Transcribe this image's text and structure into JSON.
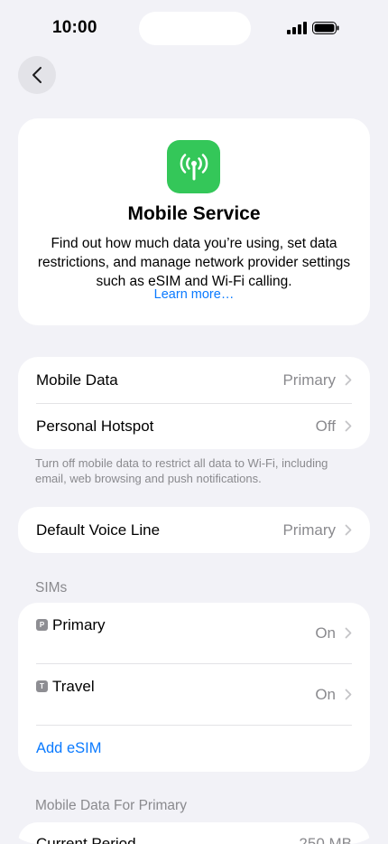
{
  "status_bar": {
    "time": "10:00"
  },
  "hero": {
    "title": "Mobile Service",
    "description": "Find out how much data you’re using, set data restrictions, and manage network provider settings such as eSIM and Wi-Fi calling.",
    "link": "Learn more…"
  },
  "data_group": {
    "rows": [
      {
        "label": "Mobile Data",
        "value": "Primary"
      },
      {
        "label": "Personal Hotspot",
        "value": "Off"
      }
    ],
    "footnote": "Turn off mobile data to restrict all data to Wi-Fi, including email, web browsing and push notifications."
  },
  "voice_group": {
    "rows": [
      {
        "label": "Default Voice Line",
        "value": "Primary"
      }
    ]
  },
  "sims": {
    "header": "SIMs",
    "items": [
      {
        "badge": "P",
        "name": "Primary",
        "value": "On"
      },
      {
        "badge": "T",
        "name": "Travel",
        "value": "On"
      }
    ],
    "add_label": "Add eSIM"
  },
  "usage": {
    "header": "Mobile Data For Primary",
    "rows": [
      {
        "label": "Current Period",
        "value": "250 MB"
      }
    ]
  },
  "colors": {
    "accent": "#0a7aff",
    "icon_green": "#34c759",
    "background": "#f2f2f7"
  }
}
